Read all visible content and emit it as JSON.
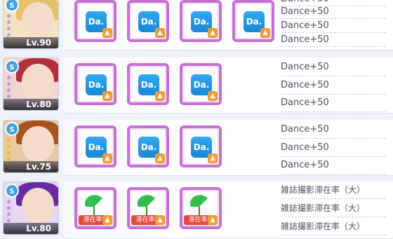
{
  "rows": [
    {
      "level": "Lv.90",
      "badge": "S",
      "hair": "#e8c06a",
      "slots": 4,
      "slot_kind": "da",
      "slot_text": "Da.",
      "effects": [
        "Dance+50",
        "Dance+50",
        "Dance+50",
        "Dance+50"
      ]
    },
    {
      "level": "Lv.80",
      "badge": "S",
      "hair": "#b3303a",
      "slots": 3,
      "slot_kind": "da",
      "slot_text": "Da.",
      "effects": [
        "Dance+50",
        "Dance+50",
        "Dance+50"
      ]
    },
    {
      "level": "Lv.75",
      "badge": "S",
      "hair": "#a85420",
      "slots": 3,
      "slot_kind": "da",
      "slot_text": "Da.",
      "effects": [
        "Dance+50",
        "Dance+50",
        "Dance+50"
      ]
    },
    {
      "level": "Lv.80",
      "badge": "S",
      "hair": "#6a2aa8",
      "slots": 3,
      "slot_kind": "stay",
      "slot_text": "滞在率",
      "effects": [
        "雑誌撮影滞在率（大）",
        "雑誌撮影滞在率（大）",
        "雑誌撮影滞在率（大）"
      ]
    }
  ]
}
